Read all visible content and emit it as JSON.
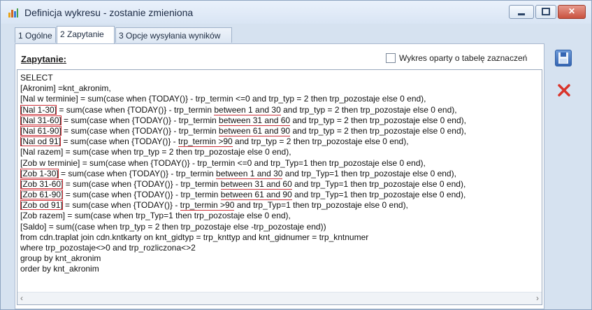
{
  "window": {
    "title": "Definicja wykresu - zostanie zmieniona",
    "buttons": {
      "minimize": "▭",
      "maximize": "▭",
      "close": "✕"
    }
  },
  "tabs": [
    {
      "label": "1 Ogólne",
      "active": false
    },
    {
      "label": "2 Zapytanie",
      "active": true
    },
    {
      "label": "3 Opcje wysyłania wyników",
      "active": false
    }
  ],
  "query_panel": {
    "label": "Zapytanie:",
    "checkbox_label": "Wykres oparty o tabelę zaznaczeń",
    "checkbox_checked": false,
    "lines": [
      "SELECT",
      "[Akronim] =knt_akronim,",
      "[Nal w terminie] = sum(case when {TODAY()} - trp_termin <=0 and trp_typ = 2 then trp_pozostaje else 0 end),",
      "[Nal 1-30] = sum(case when {TODAY()} - trp_termin between 1 and 30 and trp_typ = 2 then trp_pozostaje else 0 end),",
      "[Nal 31-60] = sum(case when {TODAY()} - trp_termin between 31 and 60 and trp_typ = 2 then trp_pozostaje else 0 end),",
      "[Nal 61-90] = sum(case when {TODAY()} - trp_termin between 61 and 90 and trp_typ = 2 then trp_pozostaje else 0 end),",
      "[Nal od 91] = sum(case when {TODAY()} - trp_termin >90 and trp_typ = 2 then trp_pozostaje else 0 end),",
      "[Nal razem] = sum(case when trp_typ = 2 then trp_pozostaje else 0 end),",
      "[Zob w terminie] = sum(case when {TODAY()} - trp_termin <=0 and trp_Typ=1 then trp_pozostaje else 0 end),",
      "[Zob 1-30] = sum(case when {TODAY()} - trp_termin between 1 and 30 and trp_Typ=1 then trp_pozostaje else 0 end),",
      "[Zob 31-60] = sum(case when {TODAY()} - trp_termin between 31 and 60 and trp_Typ=1 then trp_pozostaje else 0 end),",
      "[Zob 61-90] = sum(case when {TODAY()} - trp_termin between 61 and 90 and trp_Typ=1 then trp_pozostaje else 0 end),",
      "[Zob od 91] = sum(case when {TODAY()} - trp_termin >90 and trp_Typ=1 then trp_pozostaje else 0 end),",
      "[Zob razem] = sum(case when trp_Typ=1 then trp_pozostaje else 0 end),",
      "[Saldo] = sum((case when trp_typ = 2 then trp_pozostaje else -trp_pozostaje end))",
      "from cdn.traplat join cdn.kntkarty on knt_gidtyp = trp_knttyp and knt_gidnumer = trp_kntnumer",
      "where trp_pozostaje<>0 and trp_rozliczona<>2",
      "group by knt_akronim",
      "order by knt_akronim"
    ],
    "scroll_left_arrow": "‹",
    "scroll_right_arrow": "›"
  },
  "colors": {
    "annotation_red": "#d0333b",
    "save_icon_blue": "#3565b2",
    "delete_icon_red": "#d9342b"
  },
  "side_buttons": [
    "save-icon",
    "delete-icon"
  ]
}
